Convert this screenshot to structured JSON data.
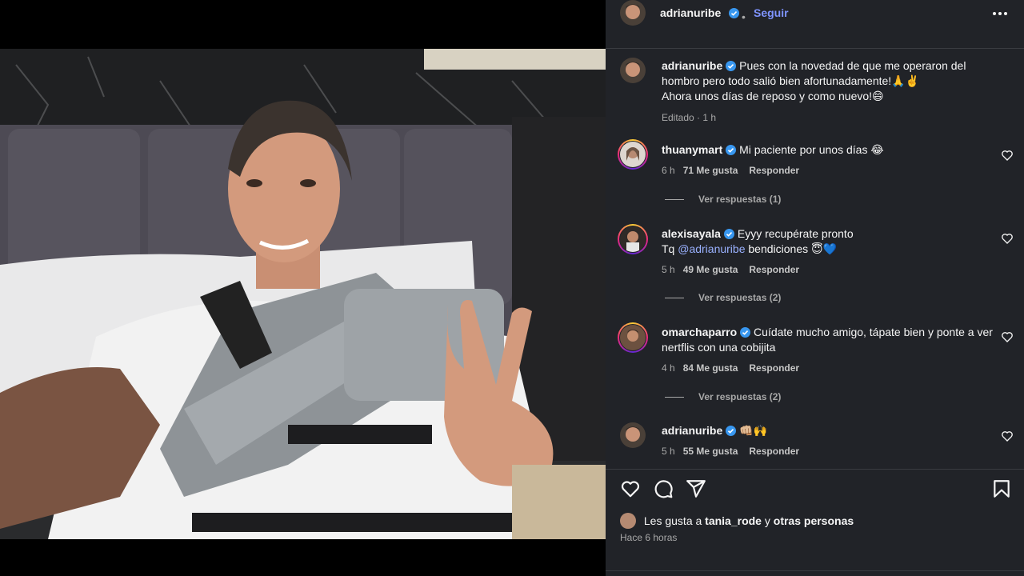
{
  "post": {
    "author": "adrianuribe",
    "follow_label": "Seguir",
    "separator": "•",
    "caption": {
      "username": "adrianuribe",
      "line1": "Pues con la novedad de que me operaron del hombro pero todo salió bien afortunadamente!🙏✌️",
      "line2": "Ahora unos días de reposo y como nuevo!😄",
      "meta": "Editado · 1 h"
    }
  },
  "comments": [
    {
      "username": "thuanymart",
      "text": "Mi paciente por unos días 😂",
      "age": "6 h",
      "likes": "71 Me gusta",
      "reply": "Responder",
      "view_replies": "Ver respuestas (1)"
    },
    {
      "username": "alexisayala",
      "text_pre": "Eyyy recupérate pronto",
      "text_tq": "Tq",
      "mention": "@adrianuribe",
      "text_post": "bendiciones 😇💙",
      "age": "5 h",
      "likes": "49 Me gusta",
      "reply": "Responder",
      "view_replies": "Ver respuestas (2)"
    },
    {
      "username": "omarchaparro",
      "text": "Cuídate mucho amigo, tápate bien y ponte a ver nertflis con una cobijita",
      "age": "4 h",
      "likes": "84 Me gusta",
      "reply": "Responder",
      "view_replies": "Ver respuestas (2)"
    },
    {
      "username": "adrianuribe",
      "text": "👊🏼🙌",
      "age": "5 h",
      "likes": "55 Me gusta",
      "reply": "Responder"
    }
  ],
  "footer": {
    "likes_prefix": "Les gusta a",
    "liker": "tania_rode",
    "likes_joiner": "y",
    "likes_suffix": "otras personas",
    "time": "Hace 6 horas"
  },
  "icons": [
    "more-options-icon",
    "verified-icon",
    "heart-icon",
    "comment-icon",
    "share-icon",
    "bookmark-icon"
  ],
  "colors": {
    "panel_bg": "#212328",
    "link": "#7f94ff",
    "verified": "#3897f0"
  }
}
